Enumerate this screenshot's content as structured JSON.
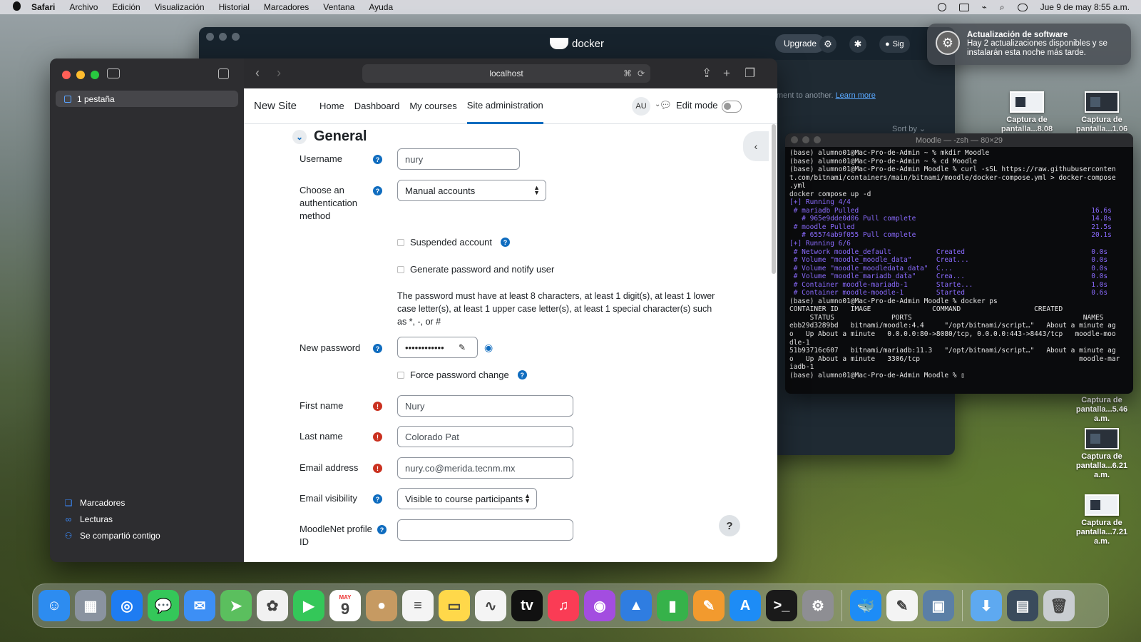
{
  "menubar": {
    "app": "Safari",
    "items": [
      "Archivo",
      "Edición",
      "Visualización",
      "Historial",
      "Marcadores",
      "Ventana",
      "Ayuda"
    ],
    "datetime": "Jue 9 de may  8:55 a.m."
  },
  "docker": {
    "title": "docker",
    "upgrade": "Upgrade",
    "sign": "Sig",
    "hint": "ment to another.",
    "learn_more": "Learn more",
    "sort_by": "Sort by"
  },
  "notification": {
    "title": "Actualización de software",
    "body": "Hay 2 actualizaciones disponibles y se instalarán esta noche más tarde."
  },
  "desktop": {
    "icons": [
      {
        "label": "Captura de pantalla...8.08 a.m."
      },
      {
        "label": "Captura de pantalla...1.06 a.m."
      },
      {
        "label": "Captura de pantalla...5.46 a.m."
      },
      {
        "label": "Captura de pantalla...6.21 a.m."
      },
      {
        "label": "Captura de pantalla...7.21 a.m."
      }
    ]
  },
  "terminal": {
    "title": "Moodle — -zsh — 80×29",
    "lines": [
      {
        "t": "(base) alumno01@Mac-Pro-de-Admin ~ % mkdir Moodle",
        "c": "w"
      },
      {
        "t": "(base) alumno01@Mac-Pro-de-Admin ~ % cd Moodle",
        "c": "w"
      },
      {
        "t": "(base) alumno01@Mac-Pro-de-Admin Moodle % curl -sSL https://raw.githubuserconten",
        "c": "w"
      },
      {
        "t": "t.com/bitnami/containers/main/bitnami/moodle/docker-compose.yml > docker-compose",
        "c": "w"
      },
      {
        "t": ".yml",
        "c": "w"
      },
      {
        "t": "docker compose up -d",
        "c": "w"
      },
      {
        "t": "[+] Running 4/4",
        "c": "p"
      },
      {
        "t": " # mariadb Pulled                                                         16.6s",
        "c": "p"
      },
      {
        "t": "   # 965e9dde0d06 Pull complete                                           14.8s",
        "c": "p"
      },
      {
        "t": " # moodle Pulled                                                          21.5s",
        "c": "p"
      },
      {
        "t": "   # 65574ab9f055 Pull complete                                           20.1s",
        "c": "p"
      },
      {
        "t": "[+] Running 6/6",
        "c": "p"
      },
      {
        "t": " # Network moodle_default           Created                               0.0s",
        "c": "p"
      },
      {
        "t": " # Volume \"moodle_moodle_data\"      Creat...                              0.0s",
        "c": "p"
      },
      {
        "t": " # Volume \"moodle_moodledata_data\"  C...                                  0.0s",
        "c": "p"
      },
      {
        "t": " # Volume \"moodle_mariadb_data\"     Crea...                               0.0s",
        "c": "p"
      },
      {
        "t": " # Container moodle-mariadb-1       Starte...                             1.0s",
        "c": "p"
      },
      {
        "t": " # Container moodle-moodle-1        Started                               0.6s",
        "c": "p"
      },
      {
        "t": "(base) alumno01@Mac-Pro-de-Admin Moodle % docker ps",
        "c": "w"
      },
      {
        "t": "CONTAINER ID   IMAGE               COMMAND                  CREATED",
        "c": "w"
      },
      {
        "t": "     STATUS              PORTS                                          NAMES",
        "c": "w"
      },
      {
        "t": "ebb29d3289bd   bitnami/moodle:4.4     \"/opt/bitnami/script…\"   About a minute ag",
        "c": "w"
      },
      {
        "t": "o   Up About a minute   0.0.0.0:80->8080/tcp, 0.0.0.0:443->8443/tcp   moodle-moo",
        "c": "w"
      },
      {
        "t": "dle-1",
        "c": "w"
      },
      {
        "t": "51b93716c607   bitnami/mariadb:11.3   \"/opt/bitnami/script…\"   About a minute ag",
        "c": "w"
      },
      {
        "t": "o   Up About a minute   3306/tcp                                       moodle-mar",
        "c": "w"
      },
      {
        "t": "iadb-1",
        "c": "w"
      },
      {
        "t": "(base) alumno01@Mac-Pro-de-Admin Moodle % ▯",
        "c": "w"
      }
    ]
  },
  "safari": {
    "tab_group": "1 pestaña",
    "url": "localhost",
    "sidebar_bottom": [
      {
        "label": "Marcadores",
        "icon": "bookmark-icon"
      },
      {
        "label": "Lecturas",
        "icon": "glasses-icon"
      },
      {
        "label": "Se compartió contigo",
        "icon": "people-icon"
      }
    ]
  },
  "moodle": {
    "site_name": "New Site",
    "nav": [
      "Home",
      "Dashboard",
      "My courses",
      "Site administration"
    ],
    "avatar": "AU",
    "edit_mode": "Edit mode",
    "section": "General",
    "username_label": "Username",
    "username_value": "nury",
    "auth_label": "Choose an authentication method",
    "auth_value": "Manual accounts",
    "suspended_label": "Suspended account",
    "genpass_label": "Generate password and notify user",
    "password_rules": "The password must have at least 8 characters, at least 1 digit(s), at least 1 lower case letter(s), at least 1 upper case letter(s), at least 1 special character(s) such as *, -, or #",
    "newpass_label": "New password",
    "newpass_value": "••••••••••••",
    "force_label": "Force password change",
    "firstname_label": "First name",
    "firstname_value": "Nury",
    "lastname_label": "Last name",
    "lastname_value": "Colorado Pat",
    "email_label": "Email address",
    "email_value": "nury.co@merida.tecnm.mx",
    "emailvis_label": "Email visibility",
    "emailvis_value": "Visible to course participants",
    "moodlenet_label": "MoodleNet profile ID",
    "moodlenet_value": "",
    "help_button": "?"
  },
  "dock": {
    "apps": [
      {
        "name": "Finder",
        "color": "#2d8cf0",
        "glyph": "☺"
      },
      {
        "name": "Launchpad",
        "color": "#8a93a0",
        "glyph": "▦"
      },
      {
        "name": "Safari",
        "color": "#1e7cf2",
        "glyph": "◎"
      },
      {
        "name": "Messages",
        "color": "#34c759",
        "glyph": "💬"
      },
      {
        "name": "Mail",
        "color": "#3d8ff5",
        "glyph": "✉"
      },
      {
        "name": "Maps",
        "color": "#5bbf5e",
        "glyph": "➤"
      },
      {
        "name": "Photos",
        "color": "#f1f1f1",
        "glyph": "✿"
      },
      {
        "name": "FaceTime",
        "color": "#34c759",
        "glyph": "▶"
      },
      {
        "name": "Calendar",
        "color": "#ffffff",
        "glyph": "9",
        "month": "MAY"
      },
      {
        "name": "Contacts",
        "color": "#c69a62",
        "glyph": "●"
      },
      {
        "name": "Reminders",
        "color": "#f4f4f4",
        "glyph": "≡"
      },
      {
        "name": "Notes",
        "color": "#ffd84a",
        "glyph": "▭"
      },
      {
        "name": "Freeform",
        "color": "#f4f4f4",
        "glyph": "∿"
      },
      {
        "name": "TV",
        "color": "#111111",
        "glyph": "tv"
      },
      {
        "name": "Music",
        "color": "#fa3c55",
        "glyph": "♫"
      },
      {
        "name": "Podcasts",
        "color": "#a34de0",
        "glyph": "◉"
      },
      {
        "name": "Keynote",
        "color": "#2f7de1",
        "glyph": "▲"
      },
      {
        "name": "Numbers",
        "color": "#36b24a",
        "glyph": "▮"
      },
      {
        "name": "Pages",
        "color": "#f29a2e",
        "glyph": "✎"
      },
      {
        "name": "App Store",
        "color": "#1d8cf6",
        "glyph": "A"
      },
      {
        "name": "Terminal",
        "color": "#1a1a1a",
        "glyph": ">_"
      },
      {
        "name": "System Settings",
        "color": "#8e8e93",
        "glyph": "⚙"
      }
    ],
    "apps2": [
      {
        "name": "Docker",
        "color": "#1d8cf6",
        "glyph": "🐳"
      },
      {
        "name": "TextEdit",
        "color": "#f4f4f4",
        "glyph": "✎"
      },
      {
        "name": "Preview",
        "color": "#5b7fa6",
        "glyph": "▣"
      }
    ],
    "apps3": [
      {
        "name": "Downloads",
        "color": "#5ea9f0",
        "glyph": "⬇"
      },
      {
        "name": "Screenshots",
        "color": "#3a4b5c",
        "glyph": "▤"
      },
      {
        "name": "Trash",
        "color": "#c9cdd1",
        "glyph": "🗑"
      }
    ]
  }
}
